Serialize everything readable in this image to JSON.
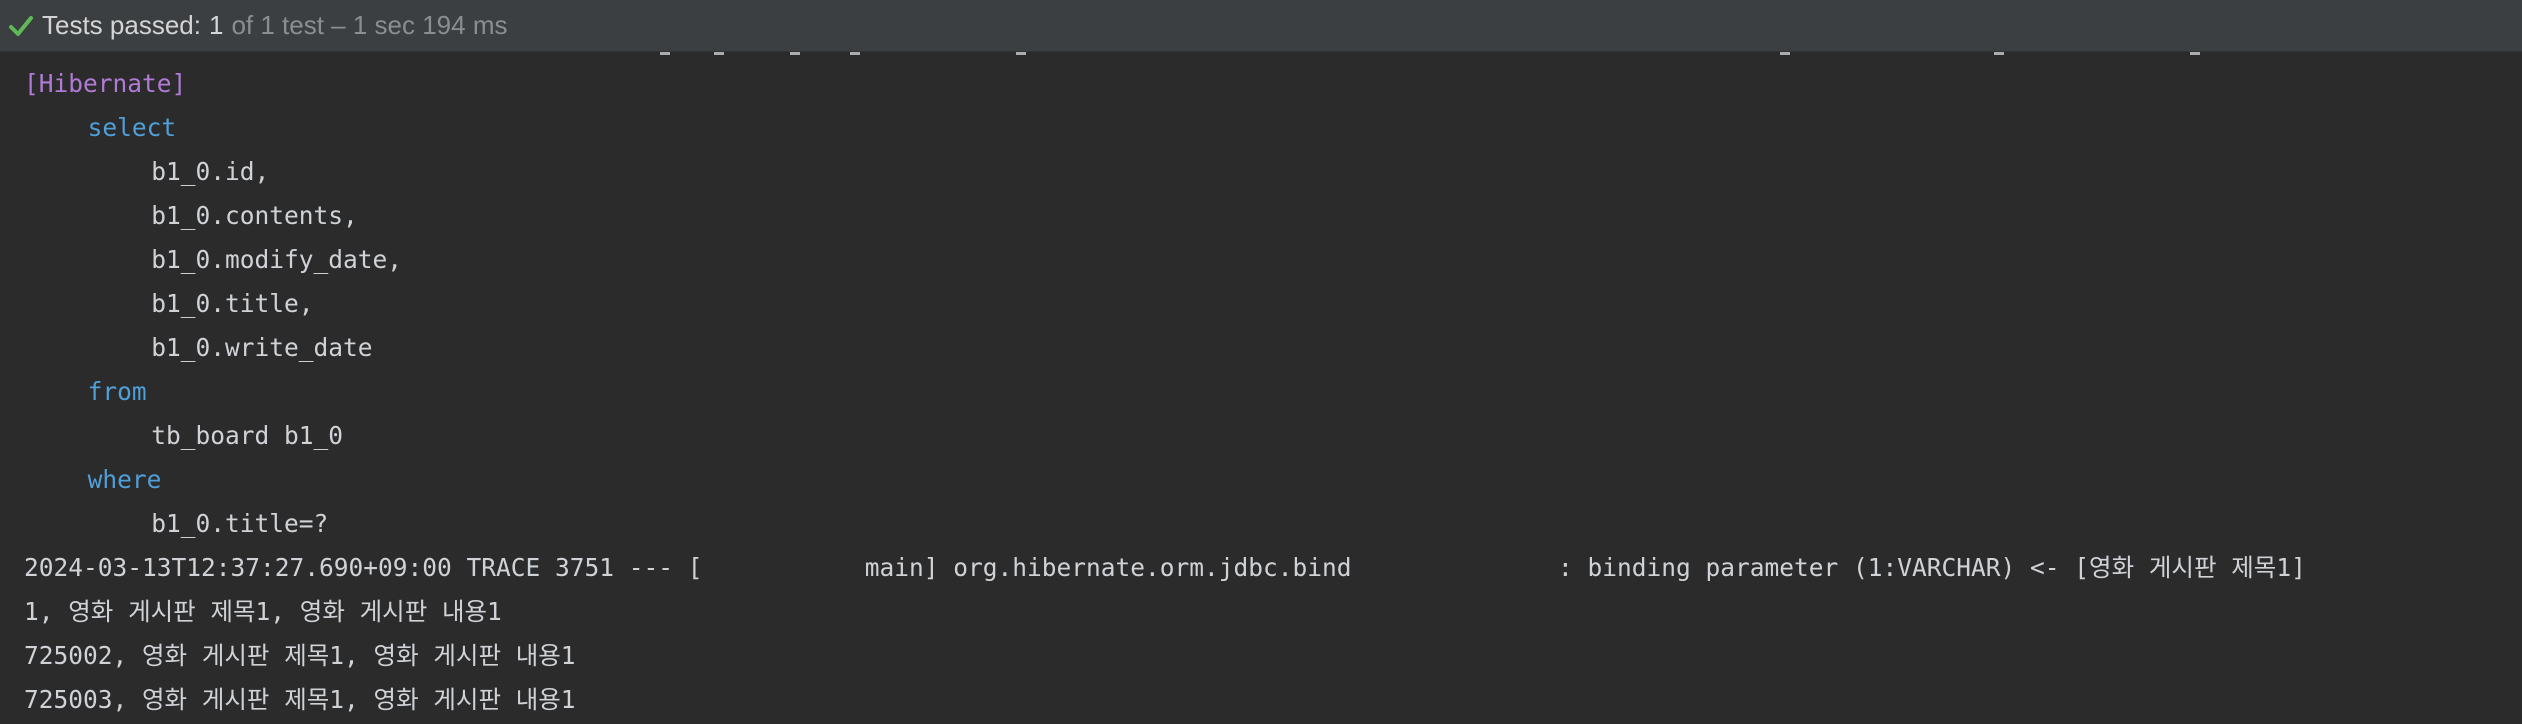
{
  "status": {
    "icon": "check-icon",
    "icon_color": "#5fb955",
    "label": "Tests passed:",
    "passed_count": "1",
    "detail": "of 1 test – 1 sec 194 ms"
  },
  "console": {
    "lines": [
      {
        "indent": 0,
        "kind": "tag",
        "text": "[Hibernate]"
      },
      {
        "indent": 4,
        "kind": "kw",
        "text": "select"
      },
      {
        "indent": 8,
        "kind": "plain",
        "text": "b1_0.id,"
      },
      {
        "indent": 8,
        "kind": "plain",
        "text": "b1_0.contents,"
      },
      {
        "indent": 8,
        "kind": "plain",
        "text": "b1_0.modify_date,"
      },
      {
        "indent": 8,
        "kind": "plain",
        "text": "b1_0.title,"
      },
      {
        "indent": 8,
        "kind": "plain",
        "text": "b1_0.write_date"
      },
      {
        "indent": 4,
        "kind": "kw",
        "text": "from"
      },
      {
        "indent": 8,
        "kind": "plain",
        "text": "tb_board b1_0"
      },
      {
        "indent": 4,
        "kind": "kw",
        "text": "where"
      },
      {
        "indent": 8,
        "kind": "plain",
        "text": "b1_0.title=?"
      },
      {
        "indent": 0,
        "kind": "plain",
        "text": "2024-03-13T12:37:27.690+09:00 TRACE 3751 --- [           main] org.hibernate.orm.jdbc.bind              : binding parameter (1:VARCHAR) <- [영화 게시판 제목1]"
      },
      {
        "indent": 0,
        "kind": "plain",
        "text": "1, 영화 게시판 제목1, 영화 게시판 내용1"
      },
      {
        "indent": 0,
        "kind": "plain",
        "text": "725002, 영화 게시판 제목1, 영화 게시판 내용1"
      },
      {
        "indent": 0,
        "kind": "plain",
        "text": "725003, 영화 게시판 제목1, 영화 게시판 내용1"
      }
    ]
  }
}
